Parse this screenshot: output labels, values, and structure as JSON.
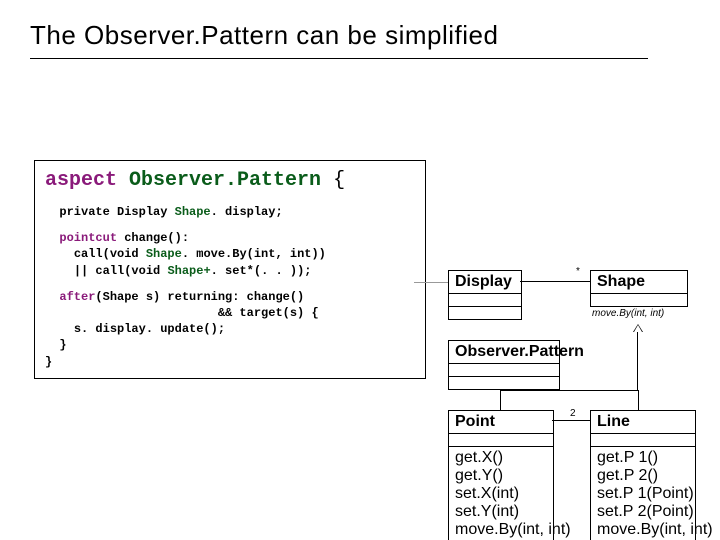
{
  "title": "The Observer.Pattern can be simplified",
  "code": {
    "kw_aspect": "aspect",
    "cls_observer": "Observer.Pattern",
    "brace_open": "{",
    "priv_decl_pre": "private Display ",
    "priv_decl_cls": "Shape",
    "priv_decl_post": ". display;",
    "pointcut_kw": "pointcut",
    "pointcut_name": " change():",
    "pc_line1a": "call(void ",
    "pc_line1_cls": "Shape",
    "pc_line1b": ". move.By(int, int))",
    "pc_line2a": "|| call(void ",
    "pc_line2_cls": "Shape+",
    "pc_line2b": ". set*(. . ));",
    "after_kw": "after",
    "after_sig1": "(Shape s) returning: change()",
    "after_sig2": "&& target(s) {",
    "after_body": "s. display. update();",
    "brace_close": "}",
    "brace_close2": "}"
  },
  "uml": {
    "display": "Display",
    "shape": "Shape",
    "shape_op": "move.By(int, int)",
    "observer": "Observer.Pattern",
    "point": "Point",
    "point_ops": [
      "get.X()",
      "get.Y()",
      "set.X(int)",
      "set.Y(int)",
      "move.By(int, int)"
    ],
    "line": "Line",
    "line_ops": [
      "get.P 1()",
      "get.P 2()",
      "set.P 1(Point)",
      "set.P 2(Point)",
      "move.By(int, int)"
    ],
    "mult_star": "*",
    "mult_two": "2"
  }
}
